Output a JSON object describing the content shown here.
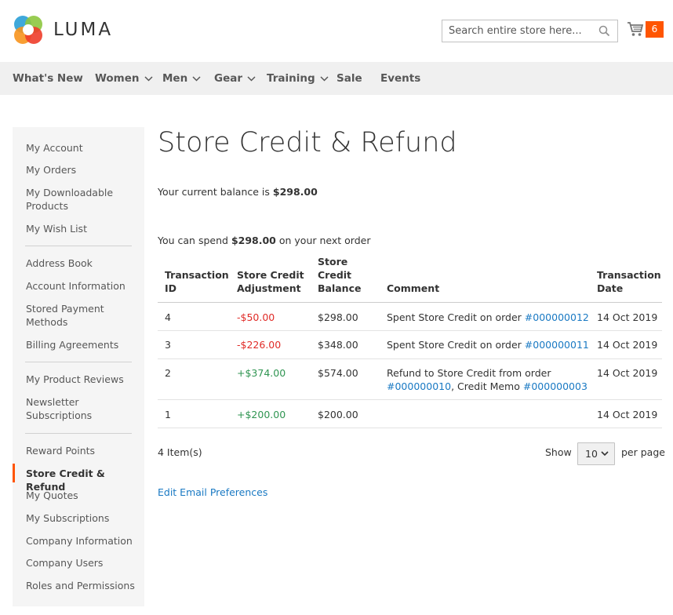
{
  "header": {
    "logo_text": "LUMA",
    "search_placeholder": "Search entire store here...",
    "cart_count": "6"
  },
  "nav": [
    {
      "label": "What's New",
      "has_submenu": false
    },
    {
      "label": "Women",
      "has_submenu": true
    },
    {
      "label": "Men",
      "has_submenu": true
    },
    {
      "label": "Gear",
      "has_submenu": true
    },
    {
      "label": "Training",
      "has_submenu": true
    },
    {
      "label": "Sale",
      "has_submenu": false
    },
    {
      "label": "Events",
      "has_submenu": false
    }
  ],
  "sidebar": {
    "items": [
      "My Account",
      "My Orders",
      "My Downloadable Products",
      "My Wish List",
      "Address Book",
      "Account Information",
      "Stored Payment Methods",
      "Billing Agreements",
      "My Product Reviews",
      "Newsletter Subscriptions",
      "Reward Points",
      "Store Credit & Refund",
      "My Quotes",
      "My Subscriptions",
      "Company Information",
      "Company Users",
      "Roles and Permissions"
    ],
    "active": "Store Credit & Refund"
  },
  "main": {
    "title": "Store Credit & Refund",
    "balance_prefix": "Your current balance is",
    "balance_value": "$298.00",
    "spend_prefix": "You can spend",
    "spend_value": "$298.00",
    "spend_suffix": "on your next order",
    "table": {
      "headers": {
        "id": "Transaction ID",
        "adjustment": "Store Credit Adjustment",
        "balance": "Store Credit Balance",
        "comment": "Comment",
        "date": "Transaction Date"
      },
      "rows": [
        {
          "id": "4",
          "adjustment": "-$50.00",
          "balance": "$298.00",
          "comment_text": "Spent Store Credit on order",
          "comment_link": "#000000012",
          "date": "14 Oct 2019"
        },
        {
          "id": "3",
          "adjustment": "-$226.00",
          "balance": "$348.00",
          "comment_text": "Spent Store Credit on order",
          "comment_link": "#000000011",
          "date": "14 Oct 2019"
        },
        {
          "id": "2",
          "adjustment": "+$374.00",
          "balance": "$574.00",
          "comment_line1": "Refund to Store Credit from order",
          "comment_link1": "#000000010",
          "comment_mid": ", Credit Memo",
          "comment_link2": "#000000003",
          "date": "14 Oct 2019"
        },
        {
          "id": "1",
          "adjustment": "+$200.00",
          "balance": "$200.00",
          "date": "14 Oct 2019"
        }
      ]
    },
    "items_count": "4 Item(s)",
    "show_label": "Show",
    "limiter_value": "10",
    "per_page_label": "per page",
    "edit_prefs": "Edit Email Preferences"
  },
  "colors": {
    "accent": "#ff5501",
    "link": "#1979c3",
    "negative": "#e02b27",
    "positive": "#309552"
  }
}
